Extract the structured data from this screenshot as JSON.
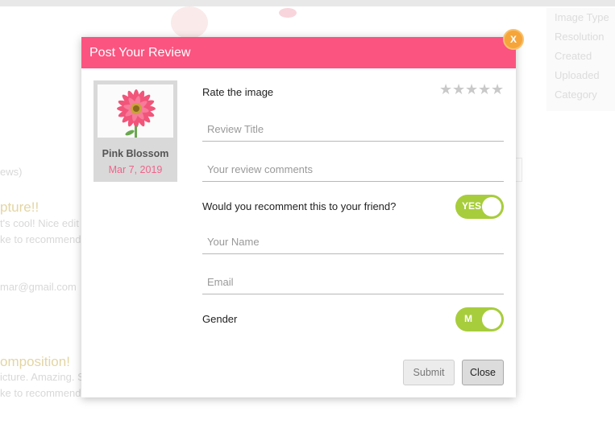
{
  "background": {
    "info_rows": [
      "Image Type",
      "Resolution",
      "Created",
      "Uploaded",
      "Category"
    ],
    "reviews_count_text": "ews)",
    "review1": {
      "heading": "pture!!",
      "line1": "t's cool! Nice edit",
      "line2": "ke to recommend"
    },
    "email_text": "mar@gmail.com",
    "review2": {
      "heading": "omposition!",
      "line1": "icture. Amazing. S",
      "line2": "ke to recommend"
    }
  },
  "modal": {
    "title": "Post Your Review",
    "close_label": "X",
    "card": {
      "name": "Pink Blossom",
      "date": "Mar 7, 2019"
    },
    "rate_label": "Rate the image",
    "rating": {
      "value": 0,
      "max": 5
    },
    "review_title_placeholder": "Review Title",
    "review_comments_placeholder": "Your review comments",
    "recommend_question": "Would you recomment this to your friend?",
    "recommend_toggle": "YES",
    "name_placeholder": "Your Name",
    "email_placeholder": "Email",
    "gender_label": "Gender",
    "gender_toggle": "M",
    "submit_label": "Submit",
    "close_button_label": "Close"
  },
  "colors": {
    "header": "#fb5480",
    "toggle_on": "#a7cd3c",
    "close_badge": "#f5a53a",
    "date_text": "#f0648b"
  }
}
